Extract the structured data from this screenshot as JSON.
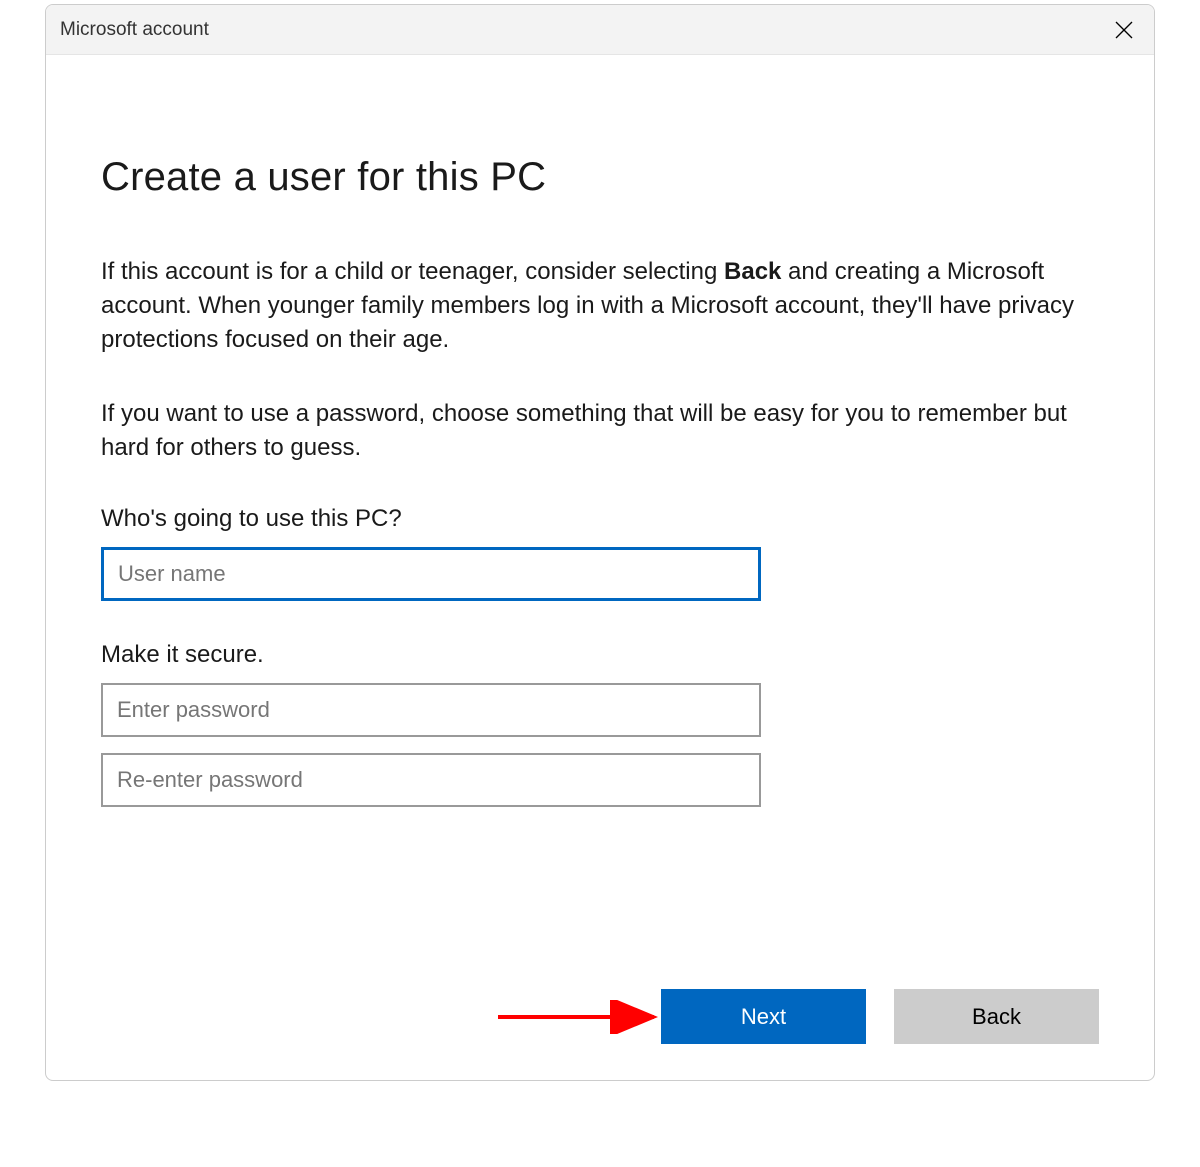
{
  "window": {
    "title": "Microsoft account"
  },
  "main": {
    "heading": "Create a user for this PC",
    "paragraph1_pre": "If this account is for a child or teenager, consider selecting ",
    "paragraph1_bold": "Back",
    "paragraph1_post": " and creating a Microsoft account. When younger family members log in with a Microsoft account, they'll have privacy protections focused on their age.",
    "paragraph2": "If you want to use a password, choose something that will be easy for you to remember but hard for others to guess.",
    "section1_label": "Who's going to use this PC?",
    "username_placeholder": "User name",
    "username_value": "",
    "section2_label": "Make it secure.",
    "password_placeholder": "Enter password",
    "password_value": "",
    "password2_placeholder": "Re-enter password",
    "password2_value": ""
  },
  "footer": {
    "next_label": "Next",
    "back_label": "Back"
  },
  "colors": {
    "accent": "#0067c0",
    "secondary_button": "#cccccc",
    "titlebar_bg": "#f3f3f3"
  }
}
